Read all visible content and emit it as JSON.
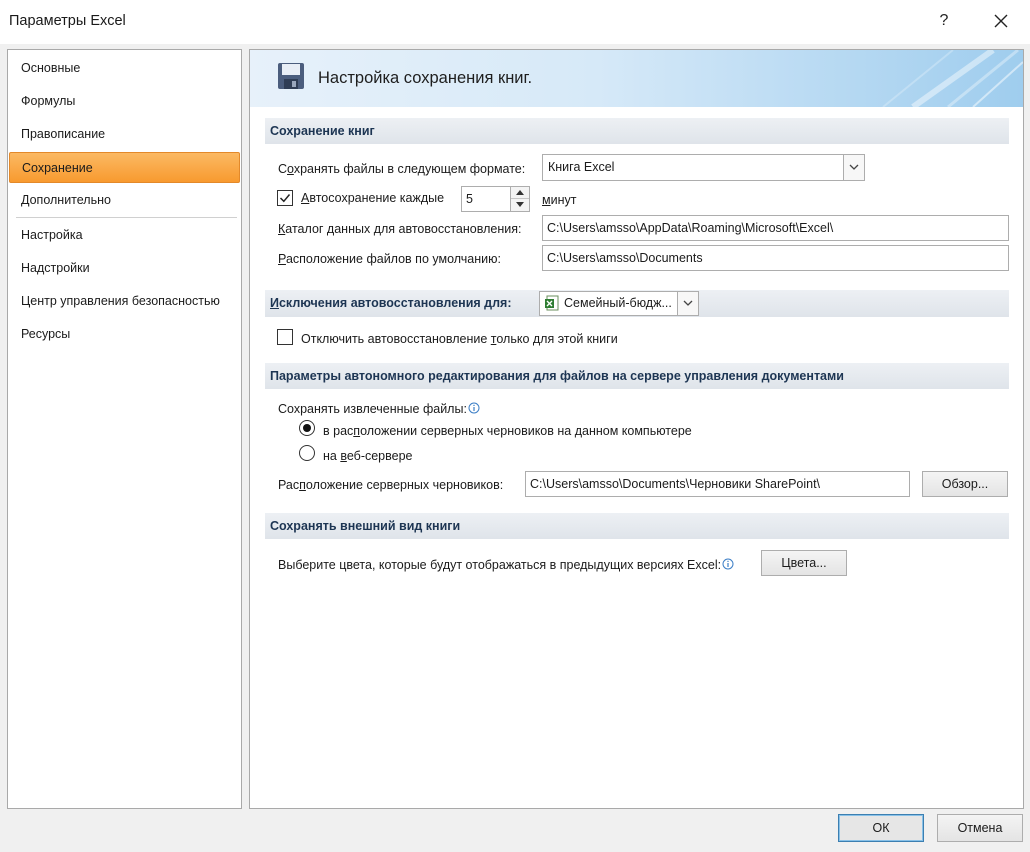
{
  "window": {
    "title": "Параметры Excel",
    "help_label": "?"
  },
  "sidebar": {
    "items": [
      {
        "label": "Основные"
      },
      {
        "label": "Формулы"
      },
      {
        "label": "Правописание"
      },
      {
        "label": "Сохранение"
      },
      {
        "label": "Дополнительно"
      },
      {
        "label": "Настройка"
      },
      {
        "label": "Надстройки"
      },
      {
        "label": "Центр управления безопасностью"
      },
      {
        "label": "Ресурсы"
      }
    ],
    "active_item": "Сохранение"
  },
  "header": {
    "title": "Настройка сохранения книг."
  },
  "save_section": {
    "title": "Сохранение книг",
    "format_label_pre": "С",
    "format_label_u": "о",
    "format_label_post": "хранять файлы в следующем формате:",
    "format_value": "Книга Excel",
    "autosave_checked": true,
    "autosave_label_u": "А",
    "autosave_label_post": "втосохранение каждые",
    "autosave_minutes": "5",
    "minutes_label_u": "м",
    "minutes_label_post": "инут",
    "autorecover_label_u": "К",
    "autorecover_label_post": "аталог данных для автовосстановления:",
    "autorecover_path": "C:\\Users\\amsso\\AppData\\Roaming\\Microsoft\\Excel\\",
    "default_location_label_u": "Р",
    "default_location_label_post": "асположение файлов по умолчанию:",
    "default_location_path": "C:\\Users\\amsso\\Documents"
  },
  "exceptions_section": {
    "title_u": "И",
    "title_post": "сключения автовосстановления для:",
    "workbook_value": "Семейный-бюдж...",
    "disable_checked": false,
    "disable_label_pre": "Отключить автовосстановление ",
    "disable_label_u": "т",
    "disable_label_post": "олько для этой книги"
  },
  "offline_section": {
    "title": "Параметры автономного редактирования для файлов на сервере управления документами",
    "save_checked_out_label": "Сохранять извлеченные файлы:",
    "option_local_pre": "в рас",
    "option_local_u": "п",
    "option_local_post": "оложении серверных черновиков на данном компьютере",
    "option_local_selected": true,
    "option_web_pre": "на ",
    "option_web_u": "в",
    "option_web_post": "еб-сервере",
    "option_web_selected": false,
    "drafts_label_pre": "Рас",
    "drafts_label_u": "п",
    "drafts_label_post": "оложение серверных черновиков:",
    "drafts_path": "C:\\Users\\amsso\\Documents\\Черновики SharePoint\\",
    "browse_label": "Обзор..."
  },
  "appearance_section": {
    "title": "Сохранять внешний вид книги",
    "colors_label": "Выберите цвета, которые будут отображаться в предыдущих версиях Excel:",
    "colors_button": "Цвета..."
  },
  "footer": {
    "ok_label": "ОК",
    "cancel_label": "Отмена"
  },
  "colors": {
    "active_nav": "#f89a2f",
    "section_title": "#1d3553",
    "banner_accent": "#9fcdee"
  }
}
